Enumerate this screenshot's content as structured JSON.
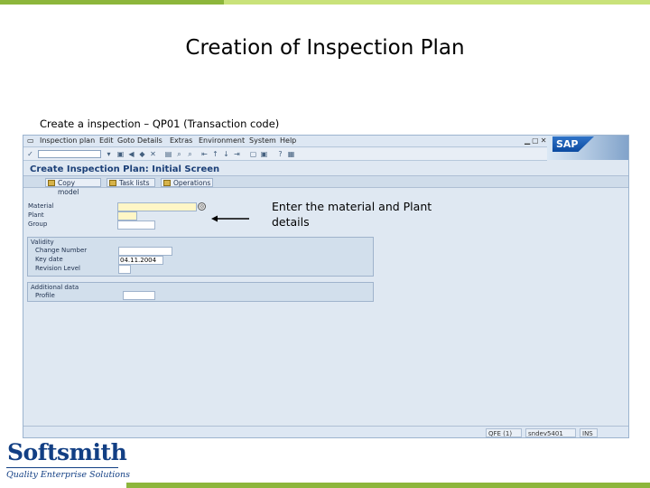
{
  "slide": {
    "title": "Creation of Inspection Plan",
    "subtitle": "Create a inspection – QP01 (Transaction code)",
    "annotation": "Enter the material and Plant details"
  },
  "sap": {
    "menu": [
      "Inspection plan",
      "Edit",
      "Goto",
      "Details",
      "Extras",
      "Environment",
      "System",
      "Help"
    ],
    "logo": "SAP",
    "screen_title": "Create Inspection Plan: Initial Screen",
    "app_buttons": [
      "Copy model",
      "Task lists",
      "Operations"
    ],
    "fields": {
      "material_label": "Material",
      "plant_label": "Plant",
      "group_label": "Group"
    },
    "validity": {
      "title": "Validity",
      "change_number_label": "Change Number",
      "key_date_label": "Key date",
      "key_date_value": "04.11.2004",
      "revision_level_label": "Revision Level"
    },
    "additional": {
      "title": "Additional data",
      "profile_label": "Profile"
    },
    "status": {
      "sid": "QFE (1)",
      "host": "sndev5401",
      "mode": "INS"
    }
  },
  "brand": {
    "name": "Softsmith",
    "tagline": "Quality Enterprise Solutions"
  },
  "colors": {
    "accent_green": "#8db63c",
    "light_green": "#c9e27a",
    "brand_blue": "#123f84",
    "sap_bg": "#dfe8f2"
  }
}
